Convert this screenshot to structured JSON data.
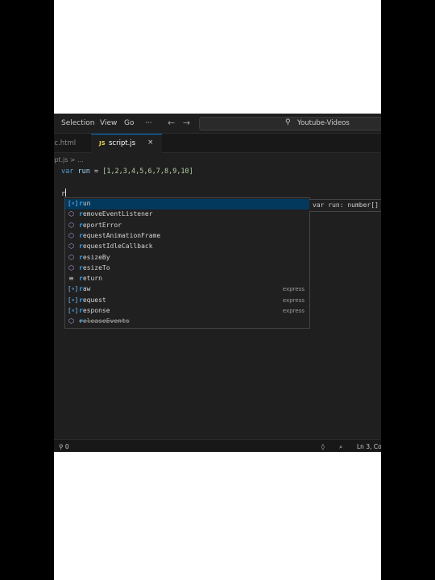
{
  "titlebar": {
    "menu": [
      "Selection",
      "View",
      "Go",
      "···"
    ],
    "back_arrow": "←",
    "forward_arrow": "→",
    "search_icon": "magnifier-icon",
    "search_label": "Youtube-Videos"
  },
  "tabs": [
    {
      "label": "ic.html",
      "active": false
    },
    {
      "label": "script.js",
      "badge": "JS",
      "active": true,
      "close": "×"
    }
  ],
  "breadcrumb": "ipt.js > ...",
  "code": {
    "line1": {
      "kw": "var",
      "id": "run",
      "op": " = ",
      "array": "[1,2,3,4,5,6,7,8,9,10]"
    },
    "line3": "r"
  },
  "suggestions": [
    {
      "icon": "variable-icon",
      "label_hl": "r",
      "label": "un",
      "detail": "",
      "selected": true
    },
    {
      "icon": "method-icon",
      "label_hl": "r",
      "label": "emoveEventListener",
      "detail": ""
    },
    {
      "icon": "method-icon",
      "label_hl": "r",
      "label": "eportError",
      "detail": ""
    },
    {
      "icon": "method-icon",
      "label_hl": "r",
      "label": "equestAnimationFrame",
      "detail": ""
    },
    {
      "icon": "method-icon",
      "label_hl": "r",
      "label": "equestIdleCallback",
      "detail": ""
    },
    {
      "icon": "method-icon",
      "label_hl": "r",
      "label": "esizeBy",
      "detail": ""
    },
    {
      "icon": "method-icon",
      "label_hl": "r",
      "label": "esizeTo",
      "detail": ""
    },
    {
      "icon": "keyword-icon",
      "label_hl": "r",
      "label": "eturn",
      "detail": ""
    },
    {
      "icon": "variable-icon",
      "label_hl": "r",
      "label": "aw",
      "detail": "express"
    },
    {
      "icon": "variable-icon",
      "label_hl": "r",
      "label": "equest",
      "detail": "express"
    },
    {
      "icon": "variable-icon",
      "label_hl": "r",
      "label": "esponse",
      "detail": "express"
    },
    {
      "icon": "method-icon",
      "label_hl": "r",
      "label": "eleaseEvents",
      "detail": "",
      "faded": true
    }
  ],
  "details_panel": "var run: number[]",
  "statusbar": {
    "left": "⚲ 0",
    "icon1": "◊",
    "icon2": "⌕",
    "position": "Ln 3, Co"
  }
}
